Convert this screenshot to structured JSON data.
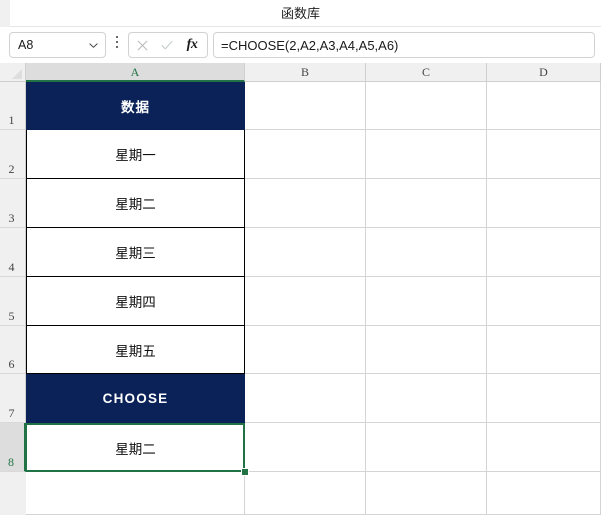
{
  "window": {
    "title": "函数库"
  },
  "formula_bar": {
    "name_box_value": "A8",
    "name_box_dropdown_icon": "chevron-down-icon",
    "more_options_icon": "kebab-menu-icon",
    "cancel_icon": "cancel-x-icon",
    "enter_icon": "confirm-check-icon",
    "insert_function_icon": "fx-icon",
    "insert_function_label": "fx",
    "formula_value": "=CHOOSE(2,A2,A3,A4,A5,A6)"
  },
  "grid": {
    "select_all_icon": "select-all-corner-icon",
    "column_headers": [
      {
        "label": "A",
        "selected": true
      },
      {
        "label": "B",
        "selected": false
      },
      {
        "label": "C",
        "selected": false
      },
      {
        "label": "D",
        "selected": false
      }
    ],
    "row_headers": [
      {
        "label": "1",
        "selected": false
      },
      {
        "label": "2",
        "selected": false
      },
      {
        "label": "3",
        "selected": false
      },
      {
        "label": "4",
        "selected": false
      },
      {
        "label": "5",
        "selected": false
      },
      {
        "label": "6",
        "selected": false
      },
      {
        "label": "7",
        "selected": false
      },
      {
        "label": "8",
        "selected": true
      }
    ],
    "cells": [
      {
        "ref": "A1",
        "value": "数据",
        "style": "header"
      },
      {
        "ref": "A2",
        "value": "星期一",
        "style": "data"
      },
      {
        "ref": "A3",
        "value": "星期二",
        "style": "data"
      },
      {
        "ref": "A4",
        "value": "星期三",
        "style": "data"
      },
      {
        "ref": "A5",
        "value": "星期四",
        "style": "data"
      },
      {
        "ref": "A6",
        "value": "星期五",
        "style": "data"
      },
      {
        "ref": "A7",
        "value": "CHOOSE",
        "style": "header-latin"
      },
      {
        "ref": "A8",
        "value": "星期二",
        "style": "result"
      }
    ],
    "active_cell": "A8"
  },
  "colors": {
    "header_fill": "#0b2259",
    "header_text": "#ffffff",
    "selection_green": "#217346",
    "gridline": "#d4d4d4",
    "header_strip": "#f0f0f0",
    "header_strip_selected": "#dddddd",
    "cell_border": "#000000"
  }
}
